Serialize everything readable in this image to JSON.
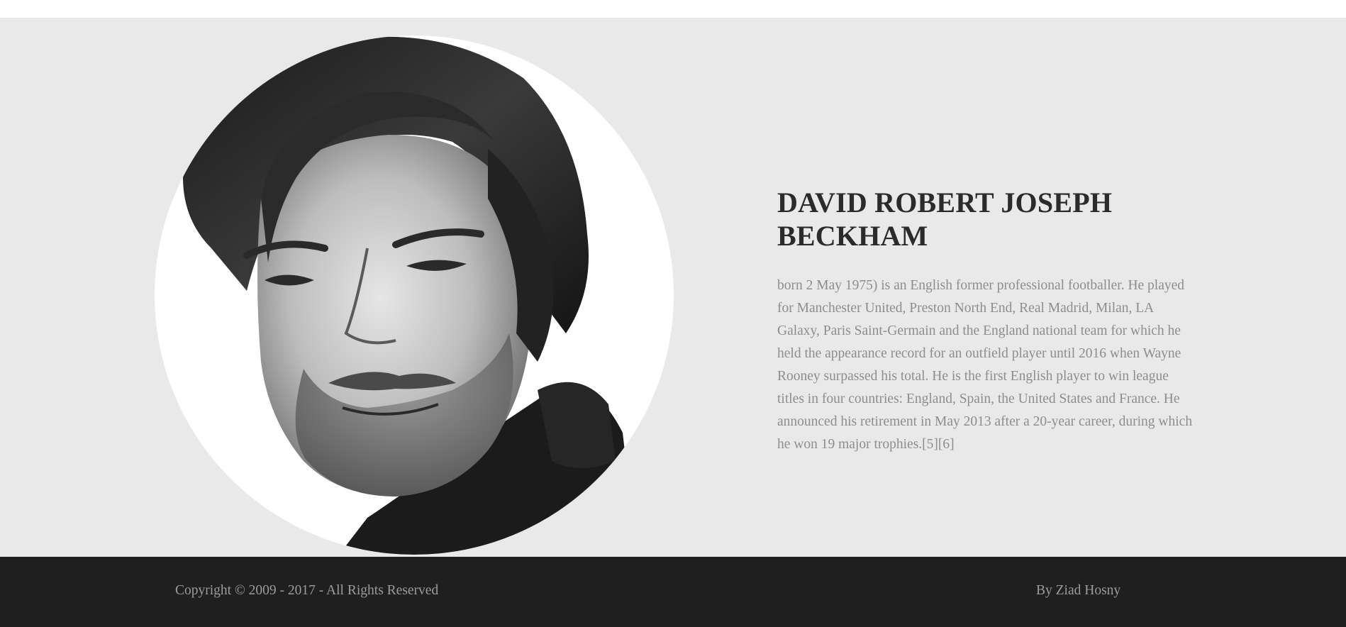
{
  "about": {
    "portrait_alt": "David Beckham portrait",
    "title": "DAVID ROBERT JOSEPH BECKHAM",
    "description": "born 2 May 1975) is an English former professional footballer. He played for Manchester United, Preston North End, Real Madrid, Milan, LA Galaxy, Paris Saint-Germain and the England national team for which he held the appearance record for an outfield player until 2016 when Wayne Rooney surpassed his total. He is the first English player to win league titles in four countries: England, Spain, the United States and France. He announced his retirement in May 2013 after a 20-year career, during which he won 19 major trophies.[5][6]"
  },
  "footer": {
    "copyright": "Copyright © 2009 - 2017 - All Rights Reserved",
    "author": "By Ziad Hosny"
  },
  "colors": {
    "section_bg": "#e9e9e9",
    "footer_bg": "#1f1f1f",
    "title": "#2b2b2b",
    "body_text": "#8d8d8d",
    "footer_text": "#9c9c9c"
  }
}
